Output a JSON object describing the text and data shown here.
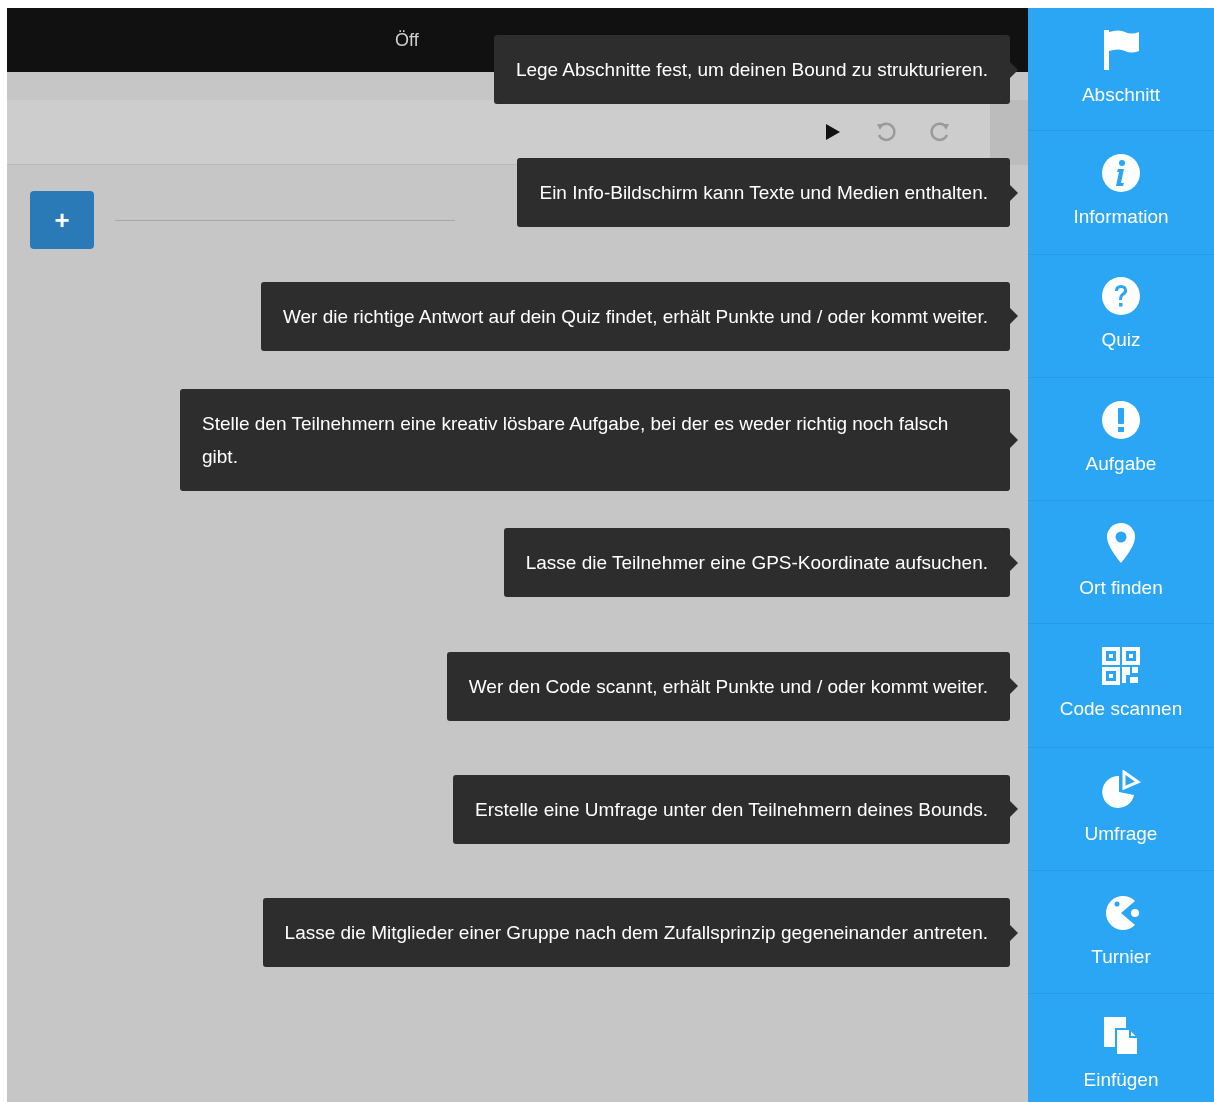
{
  "top_bar": {
    "text": "Öff"
  },
  "toolbar": {
    "buttons": [
      {
        "kind": "play"
      },
      {
        "kind": "undo"
      },
      {
        "kind": "redo"
      }
    ]
  },
  "add_button": {
    "label": "+"
  },
  "sidebar": {
    "items": [
      {
        "label": "Abschnitt",
        "kind": "flag",
        "tooltip": "Lege Abschnitte fest, um deinen Bound zu strukturieren."
      },
      {
        "label": "Information",
        "kind": "info",
        "tooltip": "Ein Info-Bildschirm kann Texte und Medien enthalten."
      },
      {
        "label": "Quiz",
        "kind": "question",
        "tooltip": "Wer die richtige Antwort auf dein Quiz findet, erhält Punkte und / oder kommt weiter."
      },
      {
        "label": "Aufgabe",
        "kind": "exclamation",
        "tooltip": "Stelle den Teilnehmern eine kreativ lösbare Aufgabe, bei der es weder richtig noch falsch gibt."
      },
      {
        "label": "Ort finden",
        "kind": "pin",
        "tooltip": "Lasse die Teilnehmer eine GPS-Koordinate aufsuchen."
      },
      {
        "label": "Code scannen",
        "kind": "qr",
        "tooltip": "Wer den Code scannt, erhält Punkte und / oder kommt weiter."
      },
      {
        "label": "Umfrage",
        "kind": "pie",
        "tooltip": "Erstelle eine Umfrage unter den Teilnehmern deines Bounds."
      },
      {
        "label": "Turnier",
        "kind": "pacman",
        "tooltip": "Lasse die Mitglieder einer Gruppe nach dem Zufallsprinzip gegeneinander antreten."
      },
      {
        "label": "Einfügen",
        "kind": "paste"
      }
    ]
  }
}
